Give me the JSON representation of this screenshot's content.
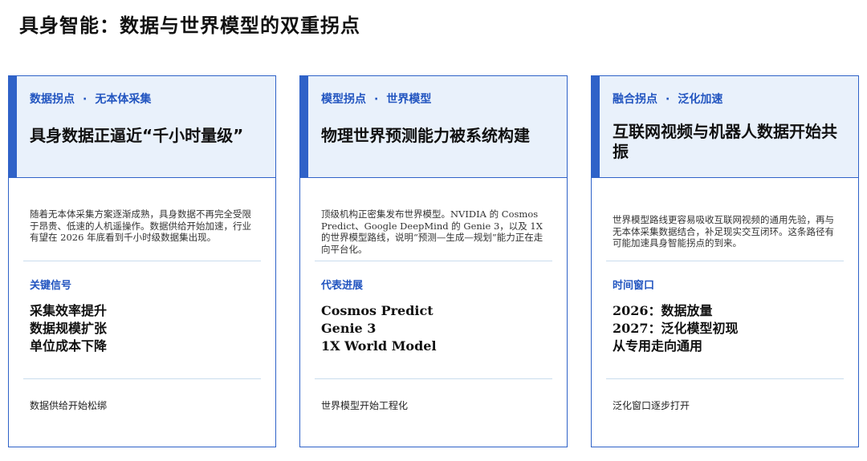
{
  "title": "具身智能：数据与世界模型的双重拐点",
  "cards": [
    {
      "tag_left": "数据拐点",
      "tag_dot": "·",
      "tag_right": "无本体采集",
      "title": "具身数据正逼近“千小时量级”",
      "description": "随着无本体采集方案逐渐成熟，具身数据不再完全受限于昂贵、低速的人机遥操作。数据供给开始加速，行业有望在 2026 年底看到千小时级数据集出现。",
      "section_label": "关键信号",
      "items": [
        "采集效率提升",
        "数据规模扩张",
        "单位成本下降"
      ],
      "footer": "数据供给开始松绑"
    },
    {
      "tag_left": "模型拐点",
      "tag_dot": "·",
      "tag_right": "世界模型",
      "title": "物理世界预测能力被系统构建",
      "description": "顶级机构正密集发布世界模型。NVIDIA 的 Cosmos Predict、Google DeepMind 的 Genie 3，以及 1X 的世界模型路线，说明“预测—生成—规划”能力正在走向平台化。",
      "section_label": "代表进展",
      "items": [
        "Cosmos Predict",
        "Genie 3",
        "1X World Model"
      ],
      "footer": "世界模型开始工程化"
    },
    {
      "tag_left": "融合拐点",
      "tag_dot": "·",
      "tag_right": "泛化加速",
      "title": "互联网视频与机器人数据开始共振",
      "description": "世界模型路线更容易吸收互联网视频的通用先验，再与无本体采集数据结合，补足现实交互闭环。这条路径有可能加速具身智能拐点的到来。",
      "section_label": "时间窗口",
      "items": [
        "2026：数据放量",
        "2027：泛化模型初现",
        "从专用走向通用"
      ],
      "footer": "泛化窗口逐步打开"
    }
  ]
}
